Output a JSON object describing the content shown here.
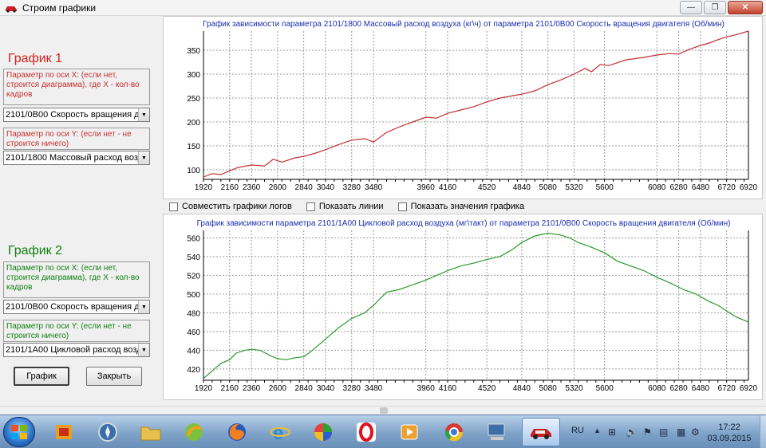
{
  "window": {
    "title": "Строим графики",
    "buttons": {
      "minimize": "—",
      "maximize": "❐",
      "close": "✕"
    }
  },
  "panel1": {
    "heading": "График 1",
    "x_label": "Параметр по оси X: (если нет, строится диаграмма), где X - кол-во кадров",
    "x_value": "2101/0B00 Скорость вращения двигателя",
    "y_label": "Параметр по оси Y: (если нет - не строится ничего)",
    "y_value": "2101/1800 Массовый расход воздуха"
  },
  "panel2": {
    "heading": "График 2",
    "x_label": "Параметр по оси X: (если нет, строится диаграмма), где X - кол-во кадров",
    "x_value": "2101/0B00 Скорость вращения двигателя",
    "y_label": "Параметр по оси Y: (если нет - не строится ничего)",
    "y_value": "2101/1A00 Цикловой расход воздуха"
  },
  "buttons": {
    "plot": "График",
    "close": "Закрыть"
  },
  "checkboxes": [
    {
      "label": "Совместить графики логов",
      "checked": false
    },
    {
      "label": "Показать линии",
      "checked": false
    },
    {
      "label": "Показать значения графика",
      "checked": false
    }
  ],
  "chart_data": [
    {
      "type": "line",
      "title": "График зависимости параметра 2101/1800 Массовый расход воздуха (кг\\ч) от параметра 2101/0B00 Скорость вращения двигателя (Об/мин)",
      "color": "#c03030",
      "xlim": [
        1920,
        6920
      ],
      "ylim": [
        80,
        390
      ],
      "xticks": [
        1920,
        2160,
        2360,
        2600,
        2840,
        3040,
        3280,
        3480,
        3960,
        4160,
        4520,
        4840,
        5080,
        5320,
        5600,
        6080,
        6280,
        6480,
        6720,
        6920
      ],
      "yticks": [
        100,
        150,
        200,
        250,
        300,
        350
      ],
      "grid": true,
      "x": [
        1920,
        2000,
        2080,
        2160,
        2240,
        2360,
        2480,
        2560,
        2640,
        2760,
        2840,
        2950,
        3040,
        3150,
        3280,
        3400,
        3480,
        3600,
        3720,
        3840,
        3960,
        4060,
        4160,
        4280,
        4400,
        4520,
        4640,
        4760,
        4840,
        4960,
        5080,
        5200,
        5320,
        5420,
        5480,
        5560,
        5640,
        5800,
        5960,
        6080,
        6200,
        6280,
        6380,
        6480,
        6560,
        6640,
        6720,
        6800,
        6920
      ],
      "y": [
        85,
        92,
        90,
        98,
        105,
        110,
        108,
        122,
        116,
        125,
        128,
        135,
        142,
        152,
        162,
        165,
        158,
        178,
        190,
        200,
        210,
        208,
        218,
        225,
        232,
        242,
        250,
        255,
        258,
        265,
        278,
        288,
        300,
        312,
        305,
        320,
        318,
        330,
        335,
        340,
        343,
        342,
        352,
        360,
        365,
        372,
        378,
        382,
        390
      ]
    },
    {
      "type": "line",
      "title": "График зависимости параметра 2101/1A00 Цикловой расход воздуха (мг\\такт) от параметра 2101/0B00 Скорость вращения двигателя (Об/мин)",
      "color": "#2a9a2a",
      "xlim": [
        1920,
        6920
      ],
      "ylim": [
        408,
        568
      ],
      "xticks": [
        1920,
        2160,
        2360,
        2600,
        2840,
        3040,
        3280,
        3480,
        3960,
        4160,
        4520,
        4840,
        5080,
        5320,
        5600,
        6080,
        6280,
        6480,
        6720,
        6920
      ],
      "yticks": [
        420,
        440,
        460,
        480,
        500,
        520,
        540,
        560
      ],
      "grid": true,
      "x": [
        1920,
        2000,
        2080,
        2160,
        2220,
        2300,
        2360,
        2440,
        2520,
        2600,
        2680,
        2760,
        2840,
        2920,
        3040,
        3160,
        3280,
        3400,
        3480,
        3600,
        3720,
        3840,
        3960,
        4060,
        4160,
        4280,
        4400,
        4520,
        4640,
        4760,
        4840,
        4960,
        5080,
        5200,
        5280,
        5360,
        5480,
        5600,
        5720,
        5840,
        5960,
        6080,
        6200,
        6320,
        6440,
        6560,
        6640,
        6720,
        6800,
        6920
      ],
      "y": [
        410,
        418,
        426,
        430,
        437,
        440,
        441,
        440,
        435,
        431,
        430,
        432,
        433,
        440,
        452,
        464,
        474,
        480,
        488,
        502,
        505,
        510,
        515,
        520,
        525,
        530,
        533,
        537,
        540,
        548,
        555,
        562,
        565,
        563,
        560,
        555,
        550,
        544,
        535,
        530,
        525,
        518,
        512,
        505,
        500,
        492,
        488,
        482,
        476,
        470
      ]
    }
  ],
  "taskbar": {
    "apps": [
      "windows-start",
      "app-icon-1",
      "app-icon-2",
      "folder",
      "app-icon-3",
      "firefox",
      "ie",
      "app-icon-4",
      "opera",
      "media",
      "chrome",
      "network",
      "car-app"
    ],
    "lang": "RU",
    "time": "17:22",
    "date": "03.09.2015"
  }
}
